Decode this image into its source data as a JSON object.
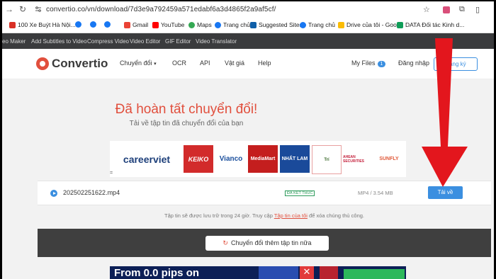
{
  "browser": {
    "url": "convertio.co/vn/download/7d3e9a792459a571edabf6a3d4865f2a9af5cf/",
    "bookmarks": [
      {
        "label": "100 Xe Buýt Hà Nội...",
        "color": "#d93025"
      },
      {
        "label": "",
        "color": "#1877f2"
      },
      {
        "label": "",
        "color": "#1877f2"
      },
      {
        "label": "",
        "color": "#1877f2"
      },
      {
        "label": "Gmail",
        "color": "#ea4335"
      },
      {
        "label": "YouTube",
        "color": "#ff0000"
      },
      {
        "label": "Maps",
        "color": "#34a853"
      },
      {
        "label": "Trang chủ",
        "color": "#1877f2"
      },
      {
        "label": "Suggested Sites",
        "color": "#0f5fa8"
      },
      {
        "label": "Trang chủ",
        "color": "#1877f2"
      },
      {
        "label": "Drive của tôi - Goo...",
        "color": "#fbbc04"
      },
      {
        "label": "DATA Đối tác Kinh d...",
        "color": "#0f9d58"
      }
    ]
  },
  "tools_bar": [
    "eo Maker",
    "Add Subtitles to Video",
    "Compress Video",
    "Video Editor",
    "GIF Editor",
    "Video Translator"
  ],
  "header": {
    "logo": "Convertio",
    "menu": [
      "Chuyển đổi",
      "OCR",
      "API",
      "Vật giá",
      "Help"
    ],
    "my_files": "My Files",
    "my_files_count": "1",
    "login": "Đăng nhập",
    "signup": "Đăng ký"
  },
  "main": {
    "title": "Đã hoàn tất chuyển đổi!",
    "subtitle": "Tải về tập tin đã chuyển đổi của bạn",
    "partner_logos": [
      "careerviet",
      "KEIKO",
      "Vianco",
      "MediaMart",
      "NHẤT LAM",
      "Trí",
      "AHEAN SECURITIES",
      "SUNFLY"
    ],
    "file": {
      "name": "202502251622.mp4",
      "status": "ĐÃ KẾT THÚC",
      "meta": "MP4 / 3.54 MB",
      "download_label": "Tải về"
    },
    "note_before": "Tập tin sẽ được lưu trữ trong 24 giờ. Truy cập",
    "note_link": "Tập tin của tôi",
    "note_after": "để xóa chúng thủ công.",
    "convert_more": "Chuyển đổi thêm tập tin nữa",
    "ad_text": "From 0.0 pips on"
  },
  "colors": {
    "brand": "#e14f3d",
    "accent": "#3b8fe0",
    "arrow": "#e3161d"
  }
}
